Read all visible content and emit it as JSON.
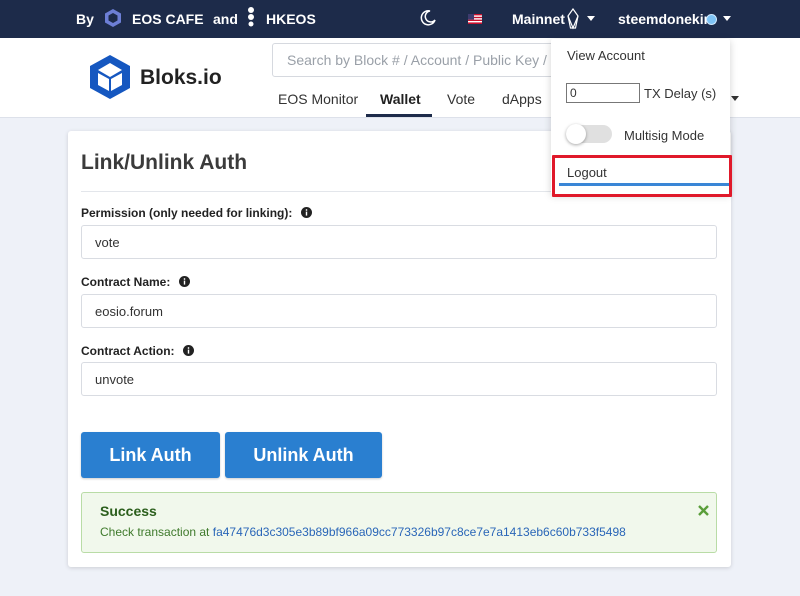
{
  "topbar": {
    "by": "By",
    "eoscafe": "EOS CAFE",
    "and": "and",
    "hkeos": "HKEOS",
    "network": "Mainnet",
    "user": "steemdonekim"
  },
  "header": {
    "brand": "Bloks.io",
    "search_placeholder": "Search by Block # / Account / Public Key / TX",
    "nav": [
      "EOS Monitor",
      "Wallet",
      "Vote",
      "dApps"
    ],
    "active_nav": "Wallet"
  },
  "card": {
    "title": "Link/Unlink Auth",
    "permission_label": "Permission (only needed for linking):",
    "permission_value": "vote",
    "contract_label": "Contract Name:",
    "contract_value": "eosio.forum",
    "action_label": "Contract Action:",
    "action_value": "unvote",
    "link_button": "Link Auth",
    "unlink_button": "Unlink Auth"
  },
  "alert": {
    "title": "Success",
    "message": "Check transaction at",
    "tx": "fa47476d3c305e3b89bf966a09cc773326b97c8ce7e7a1413eb6c60b733f5498"
  },
  "dropdown": {
    "view_account": "View Account",
    "tx_delay_value": "0",
    "tx_delay_label": "TX Delay (s)",
    "multisig_label": "Multisig Mode",
    "multisig_on": false,
    "logout": "Logout"
  },
  "colors": {
    "topbar": "#1d2b4a",
    "button": "#2a7fd0",
    "highlight": "#e0192a",
    "success_bg": "#f1f8ec"
  }
}
